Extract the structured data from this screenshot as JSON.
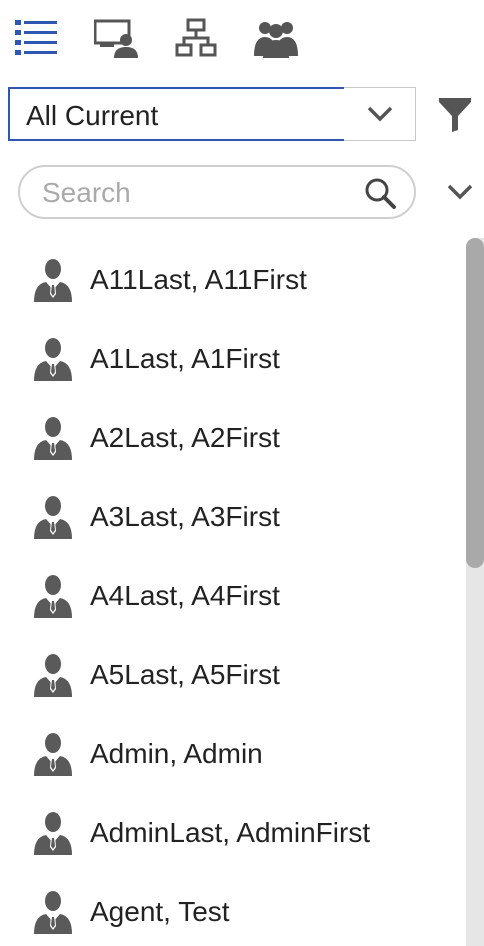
{
  "toolbar": {
    "icons": [
      "list-view-icon",
      "desktop-user-icon",
      "org-chart-icon",
      "group-icon"
    ],
    "accent_color": "#2f56b0",
    "icon_color": "#555555"
  },
  "filter": {
    "selected": "All Current"
  },
  "search": {
    "placeholder": "Search"
  },
  "list": {
    "items": [
      {
        "label": "A11Last, A11First"
      },
      {
        "label": "A1Last, A1First"
      },
      {
        "label": "A2Last, A2First"
      },
      {
        "label": "A3Last, A3First"
      },
      {
        "label": "A4Last, A4First"
      },
      {
        "label": "A5Last, A5First"
      },
      {
        "label": "Admin, Admin"
      },
      {
        "label": "AdminLast, AdminFirst"
      },
      {
        "label": "Agent, Test"
      }
    ]
  }
}
